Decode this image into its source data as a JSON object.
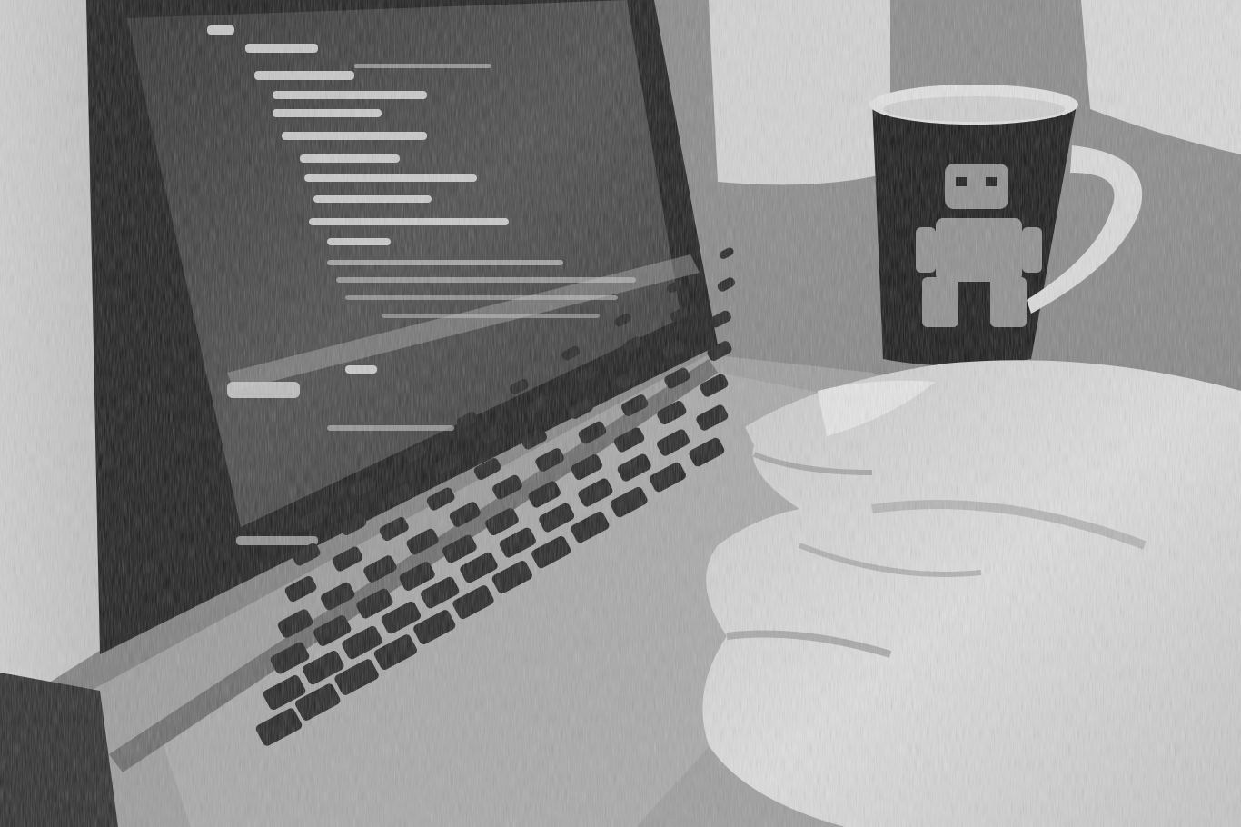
{
  "scene": {
    "subject": "laptop-with-code-hands-typing-and-mug",
    "style": "grayscale-sketch-filter",
    "palette": {
      "background": "#7a7a7a",
      "wall_light": "#d9d9d9",
      "screen_dark": "#3a3a3a",
      "code_light": "#e6e6e6",
      "laptop_body": "#9a9a9a",
      "bezel": "#1a1a1a",
      "keys": "#222222",
      "mug": "#151515",
      "mug_decal": "#8c8c8c",
      "hand": "#d2d2d2",
      "desk": "#8a8a8a"
    }
  }
}
